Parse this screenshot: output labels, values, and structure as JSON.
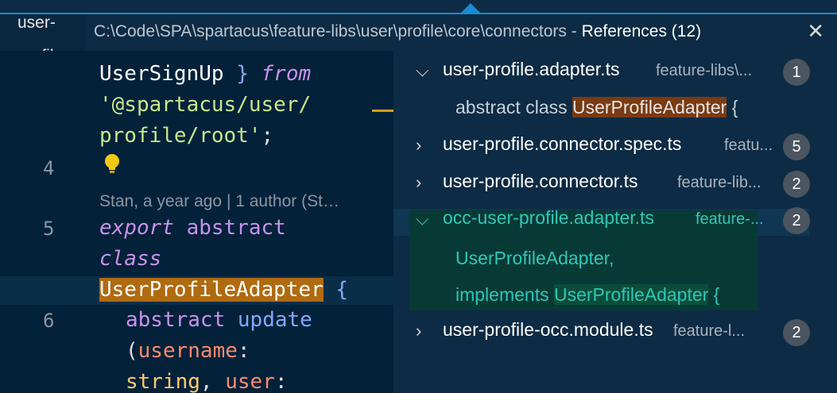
{
  "tab": {
    "label": "user-profil"
  },
  "peek": {
    "path": "C:\\Code\\SPA\\spartacus\\feature-libs\\user\\profile\\core\\connectors",
    "separator": " - ",
    "title": "References (12)",
    "close_icon": "close-icon"
  },
  "editor": {
    "gutter": [
      "4",
      "5",
      "6"
    ],
    "lines": {
      "l1_ident": "UserSignUp",
      "l1_brace": " } ",
      "l1_from": "from",
      "l2": "'@spartacus/user/",
      "l3_str": "profile/root'",
      "l3_semi": ";",
      "codelens": "Stan, a year ago | 1 author (St…",
      "l5_export": "export",
      "l5_abstract": " abstract",
      "l6_class": "class",
      "l7_name": "UserProfileAdapter",
      "l7_brace": " {",
      "l8_abstract": "abstract",
      "l8_update": " update",
      "l9_paren": "(",
      "l9_param": "username",
      "l9_colon": ":",
      "l10_type": "string",
      "l10_comma": ", ",
      "l10_param": "user",
      "l10_colon": ":"
    },
    "lightbulb_icon": "lightbulb-icon"
  },
  "references": {
    "files": [
      {
        "name": "user-profile.adapter.ts",
        "path": "feature-libs\\...",
        "count": "1",
        "expanded": true
      },
      {
        "name": "user-profile.connector.spec.ts",
        "path": "featu...",
        "count": "5",
        "expanded": false
      },
      {
        "name": "user-profile.connector.ts",
        "path": "feature-lib...",
        "count": "2",
        "expanded": false
      },
      {
        "name": "occ-user-profile.adapter.ts",
        "path": "feature-...",
        "count": "2",
        "expanded": true
      },
      {
        "name": "user-profile-occ.module.ts",
        "path": "feature-l...",
        "count": "2",
        "expanded": false
      }
    ],
    "match1": {
      "prefix": "abstract class ",
      "highlight": "UserProfileAdapter",
      "suffix": " {"
    },
    "match2": {
      "highlight": "UserProfileAdapter",
      "suffix": ","
    },
    "match3": {
      "prefix": "implements ",
      "highlight": "UserProfileAdapter",
      "suffix": " {"
    },
    "colors": {
      "accent": "#1a8ad4",
      "selected_text": "#2ec7b7",
      "match_highlight": "#7a3a12",
      "class_highlight": "#b06a10"
    }
  }
}
